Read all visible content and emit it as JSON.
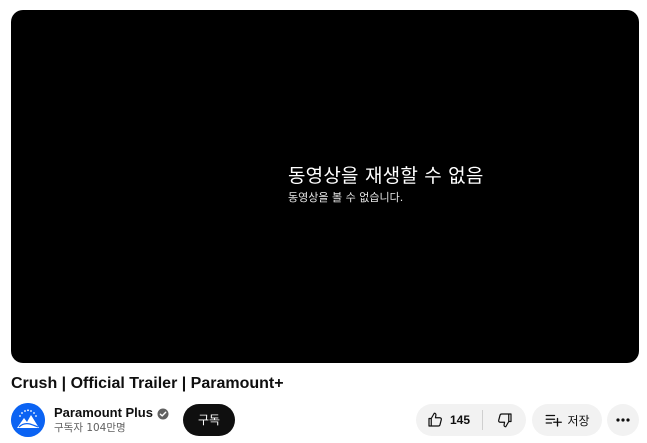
{
  "player": {
    "error_title": "동영상을 재생할 수 없음",
    "error_subtitle": "동영상을 볼 수 없습니다."
  },
  "video": {
    "title": "Crush | Official Trailer | Paramount+"
  },
  "channel": {
    "name": "Paramount Plus",
    "subscribers": "구독자 104만명",
    "verified_icon": "verified-check-icon",
    "avatar_color": "#0b63f3"
  },
  "actions": {
    "subscribe_label": "구독",
    "like_count": "145",
    "save_label": "저장",
    "like_icon": "thumbs-up-icon",
    "dislike_icon": "thumbs-down-icon",
    "save_icon": "playlist-add-icon",
    "more_icon": "more-horizontal-icon"
  }
}
